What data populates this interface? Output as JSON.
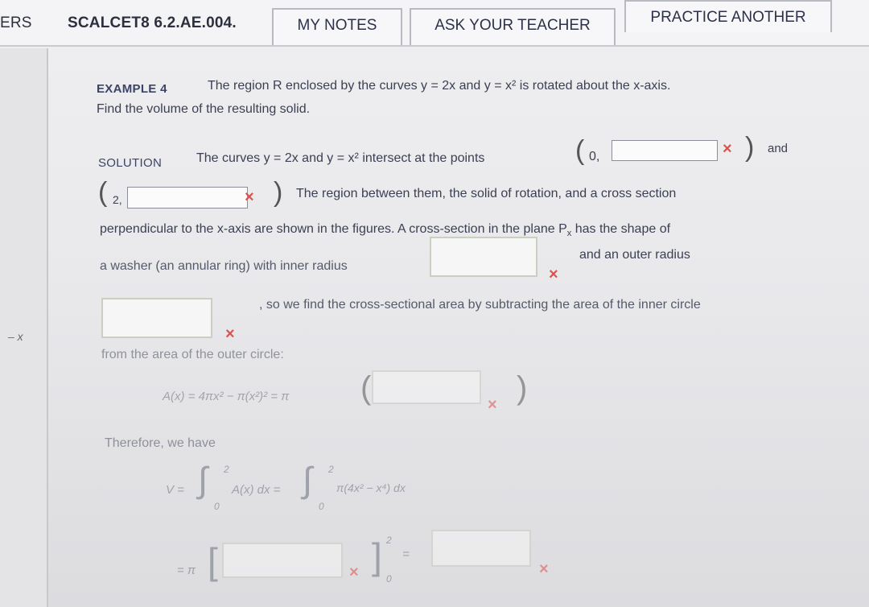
{
  "topbar": {
    "left_cut": "ERS",
    "course_code": "SCALCET8 6.2.AE.004.",
    "my_notes": "MY NOTES",
    "ask_teacher": "ASK YOUR TEACHER",
    "practice_another": "PRACTICE ANOTHER"
  },
  "problem": {
    "example_label": "EXAMPLE 4",
    "statement_1": "The region R enclosed by the curves y = 2x and y = x² is rotated about the x-axis.",
    "statement_2": "Find the volume of the resulting solid."
  },
  "solution": {
    "label": "SOLUTION",
    "line1": "The curves y = 2x and y = x² intersect at the points",
    "point1_prefix": "0,",
    "and": "and",
    "point2_prefix": "2,",
    "line2": "The region between them, the solid of rotation, and a cross section",
    "line3": "perpendicular to the x-axis are shown in the figures. A cross-section in the plane P",
    "line3_sub": "x",
    "line3_end": "has the shape of",
    "line4": "a washer (an annular ring) with inner radius",
    "line4_end": "and an outer radius",
    "line5": ", so we find the cross-sectional area by subtracting the area of the inner circle",
    "line6": "from the area of the outer circle:",
    "area_formula": "A(x) = 4πx² − π(x²)² = π",
    "therefore": "Therefore, we have",
    "volume_formula_left": "V =",
    "integral_upper": "2",
    "integral_lower": "0",
    "integrand_1": "A(x) dx =",
    "integrand_2": "π(4x² − x⁴) dx",
    "equals_pi": "= π",
    "bracket_upper": "2",
    "bracket_lower": "0",
    "equals": "="
  },
  "inputs": {
    "point1_y": "",
    "point2_y": "",
    "inner_radius": "",
    "outer_radius": "",
    "area_expr": "",
    "antiderivative": "",
    "final_volume": ""
  },
  "icons": {
    "wrong": "×"
  },
  "colors": {
    "wrong": "#d9534f"
  }
}
